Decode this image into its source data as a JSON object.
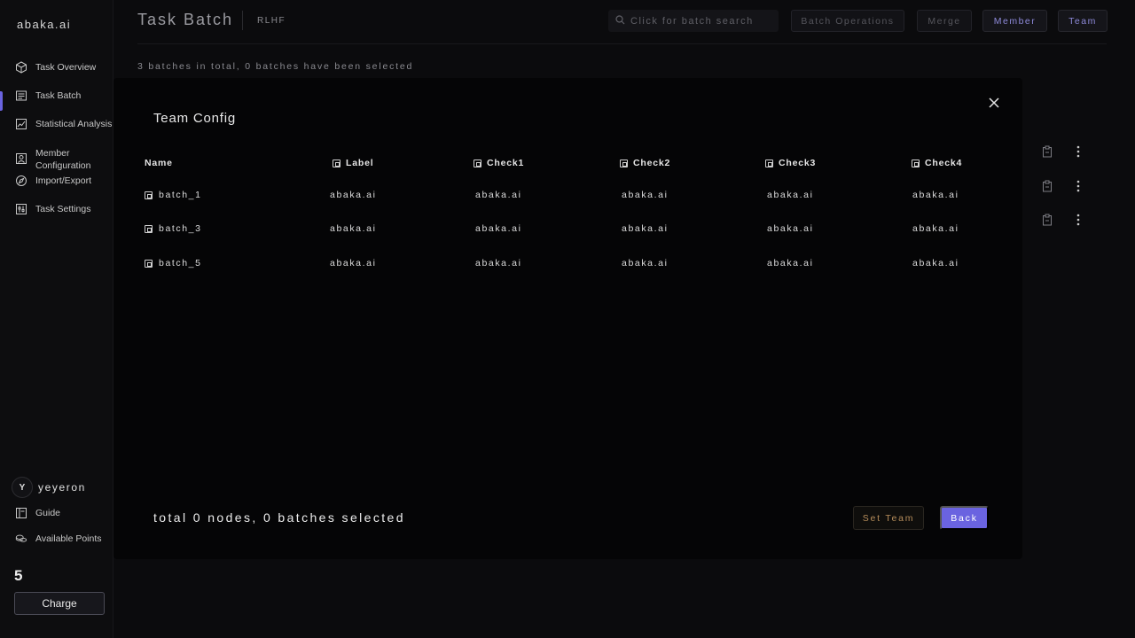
{
  "sidebar": {
    "brand": "abaka.ai",
    "nav": [
      {
        "label": "Task Overview",
        "icon": "cube-icon"
      },
      {
        "label": "Task Batch",
        "icon": "list-icon",
        "active": true
      },
      {
        "label": "Statistical Analysis",
        "icon": "chart-icon"
      },
      {
        "label": "Member Configuration",
        "line1": "Member",
        "line2": "Configuration",
        "icon": "person-icon"
      },
      {
        "label": "Import/Export",
        "icon": "compass-icon"
      },
      {
        "label": "Task Settings",
        "icon": "sliders-icon"
      }
    ],
    "user": {
      "initial": "Y",
      "name": "yeyeron"
    },
    "bottom_nav": [
      {
        "label": "Guide",
        "icon": "book-icon"
      },
      {
        "label": "Available Points",
        "icon": "coins-icon"
      }
    ],
    "points_value": "5",
    "charge_label": "Charge"
  },
  "header": {
    "title": "Task Batch",
    "tag": "RLHF",
    "search_placeholder": "Click for batch search",
    "buttons": {
      "batch_operations": "Batch Operations",
      "merge": "Merge",
      "member": "Member",
      "team": "Team"
    },
    "summary": "3 batches in total, 0 batches have been selected"
  },
  "modal": {
    "title": "Team Config",
    "columns": [
      "Name",
      "Label",
      "Check1",
      "Check2",
      "Check3",
      "Check4"
    ],
    "rows": [
      {
        "name": "batch_1",
        "cells": [
          "abaka.ai",
          "abaka.ai",
          "abaka.ai",
          "abaka.ai",
          "abaka.ai"
        ]
      },
      {
        "name": "batch_3",
        "cells": [
          "abaka.ai",
          "abaka.ai",
          "abaka.ai",
          "abaka.ai",
          "abaka.ai"
        ]
      },
      {
        "name": "batch_5",
        "cells": [
          "abaka.ai",
          "abaka.ai",
          "abaka.ai",
          "abaka.ai",
          "abaka.ai"
        ]
      }
    ],
    "footer_text": "total 0 nodes, 0 batches selected",
    "set_team_label": "Set Team",
    "back_label": "Back"
  },
  "colors": {
    "accent": "#6a63e0",
    "set_team_text": "#b58c5a"
  }
}
